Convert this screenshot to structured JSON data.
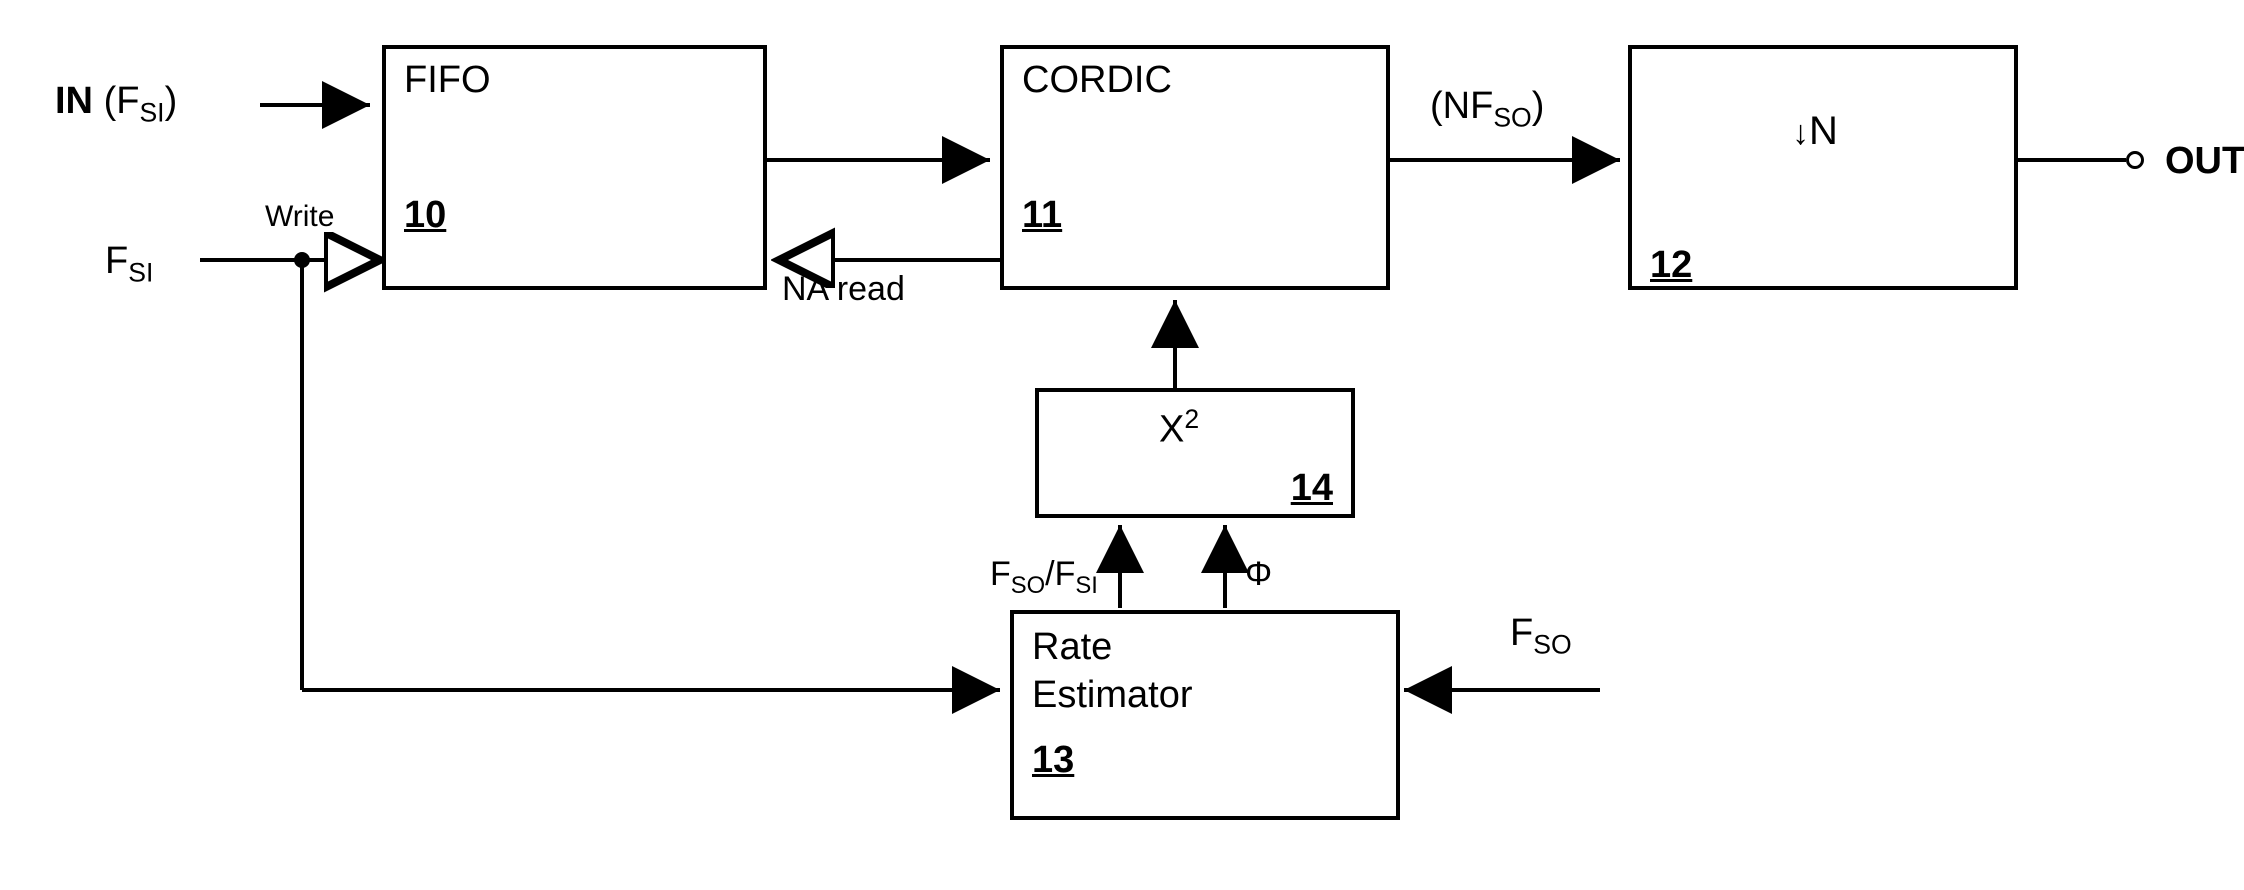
{
  "inputs": {
    "in_label": "IN",
    "in_fsi": "(F",
    "in_fsi_sub": "SI",
    "in_fsi_close": ")",
    "fsi_label": "F",
    "fsi_sub": "SI",
    "write_label": "Write"
  },
  "outputs": {
    "out_label": "OUT",
    "out_fso": "(F",
    "out_fso_sub": "SO",
    "out_fso_close": ")",
    "fso_label": "F",
    "fso_sub": "SO"
  },
  "blocks": {
    "fifo": {
      "title": "FIFO",
      "ref": "10"
    },
    "cordic": {
      "title": "CORDIC",
      "ref": "11"
    },
    "downsample": {
      "arrow": "↓",
      "n": "N",
      "ref": "12"
    },
    "rate_estimator": {
      "title1": "Rate",
      "title2": "Estimator",
      "ref": "13"
    },
    "squarer": {
      "x": "X",
      "sup": "2",
      "ref": "14"
    }
  },
  "signals": {
    "na_read": "NA read",
    "nfso": "(NF",
    "nfso_sub": "SO",
    "nfso_close": ")",
    "ratio_f": "F",
    "ratio_so": "SO",
    "ratio_slash": "/F",
    "ratio_si": "SI",
    "phi": "Φ"
  }
}
